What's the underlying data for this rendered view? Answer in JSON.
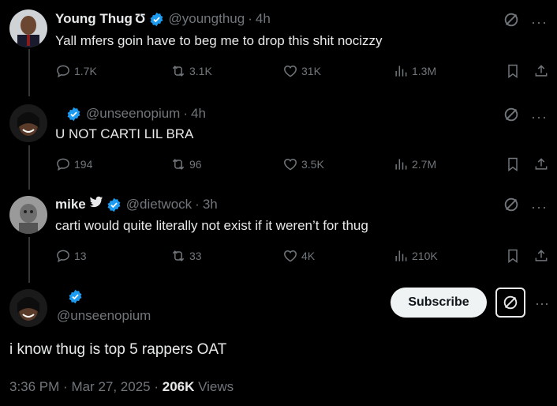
{
  "colors": {
    "verified": "#1d9bf0",
    "text": "#e7e9ea",
    "muted": "#71767b",
    "background": "#000000"
  },
  "tweets": [
    {
      "name": "Young Thug",
      "name_glyph": "Ʊ",
      "handle": "@youngthug",
      "time": "4h",
      "text": "Yall mfers goin have to beg me to drop this shit nocizzy",
      "replies": "1.7K",
      "reposts": "3.1K",
      "likes": "31K",
      "views": "1.3M"
    },
    {
      "name": "",
      "handle": "@unseenopium",
      "time": "4h",
      "text": "U NOT CARTI LIL BRA",
      "replies": "194",
      "reposts": "96",
      "likes": "3.5K",
      "views": "2.7M"
    },
    {
      "name": "mike",
      "handle": "@dietwock",
      "time": "3h",
      "text": "carti would quite literally not exist if it weren’t for thug",
      "replies": "13",
      "reposts": "33",
      "likes": "4K",
      "views": "210K"
    }
  ],
  "main_tweet": {
    "handle": "@unseenopium",
    "subscribe_label": "Subscribe",
    "text": "i know thug is top 5 rappers OAT",
    "time": "3:36 PM",
    "date": "Mar 27, 2025",
    "views_count": "206K",
    "views_label": "Views"
  }
}
